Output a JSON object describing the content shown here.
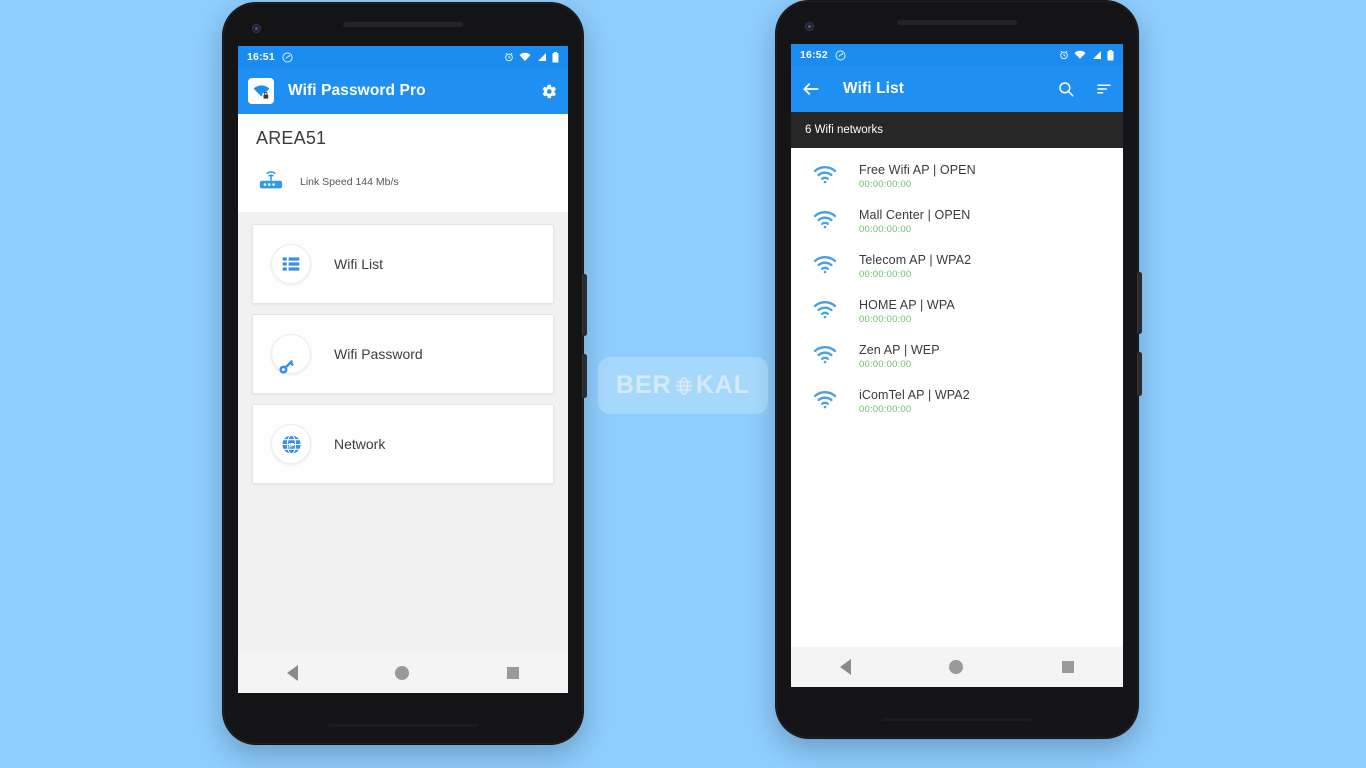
{
  "background_color": "#8ecdfc",
  "accent_color": "#1f90f2",
  "left_phone": {
    "status_bar": {
      "time": "16:51",
      "left_icons": [
        "screenshot-icon"
      ],
      "right_icons": [
        "alarm-icon",
        "wifi-icon",
        "signal-icon",
        "battery-icon"
      ]
    },
    "app_bar": {
      "app_icon": "wifi-lock-icon",
      "title": "Wifi Password Pro",
      "action_icon": "gear-icon"
    },
    "connection": {
      "ssid": "AREA51",
      "link_icon": "router-icon",
      "link_speed_label": "Link Speed 144 Mb/s"
    },
    "menu_items": [
      {
        "icon": "list-icon",
        "label": "Wifi List"
      },
      {
        "icon": "key-icon",
        "label": "Wifi Password"
      },
      {
        "icon": "globe-icon",
        "label": "Network"
      }
    ],
    "nav_bar": [
      "back-nav-icon",
      "home-nav-icon",
      "recents-nav-icon"
    ]
  },
  "right_phone": {
    "status_bar": {
      "time": "16:52",
      "left_icons": [
        "screenshot-icon"
      ],
      "right_icons": [
        "alarm-icon",
        "wifi-icon",
        "signal-icon",
        "battery-icon"
      ]
    },
    "app_bar": {
      "back_icon": "back-arrow-icon",
      "title": "Wifi List",
      "actions": [
        "search-icon",
        "sort-icon"
      ]
    },
    "subtitle": "6 Wifi networks",
    "networks": [
      {
        "icon": "wifi-icon",
        "name": "Free Wifi AP | OPEN",
        "mac": "00:00:00:00"
      },
      {
        "icon": "wifi-icon",
        "name": "Mall Center | OPEN",
        "mac": "00:00:00:00"
      },
      {
        "icon": "wifi-icon",
        "name": "Telecom AP | WPA2",
        "mac": "00:00:00:00"
      },
      {
        "icon": "wifi-icon",
        "name": "HOME AP | WPA",
        "mac": "00:00:00:00"
      },
      {
        "icon": "wifi-icon",
        "name": "Zen AP | WEP",
        "mac": "00:00:00:00"
      },
      {
        "icon": "wifi-icon",
        "name": "iComTel AP | WPA2",
        "mac": "00:00:00:00"
      }
    ],
    "nav_bar": [
      "back-nav-icon",
      "home-nav-icon",
      "recents-nav-icon"
    ]
  },
  "watermark": {
    "text_before": "BER",
    "text_after": "KAL",
    "icon": "globe-icon"
  }
}
